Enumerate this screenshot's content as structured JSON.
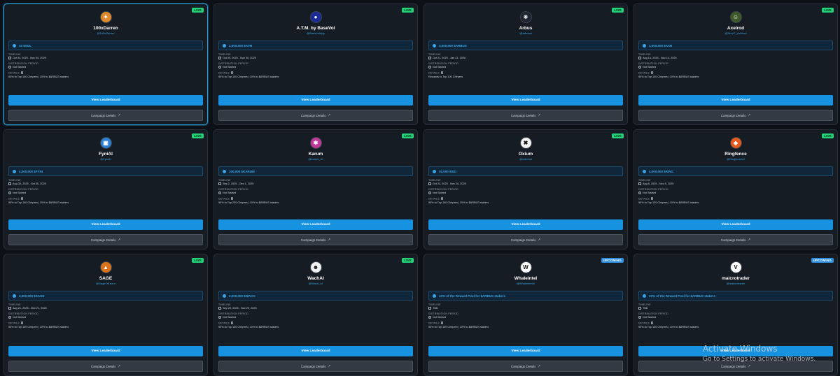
{
  "labels": {
    "timeline": "TIMELINE",
    "distribution": "DISTRIBUTION PERIOD",
    "details": "DETAILS",
    "view_leaderboard": "View Leaderboard",
    "campaign_details": "Campaign Details"
  },
  "campaigns": [
    {
      "name": "100xDarren",
      "handle": "@100xDarren",
      "status": "LIVE",
      "reward": "10 $SOL",
      "timeline": "Oct 04, 2025 - Nov 04, 2025",
      "distribution": "Not Started",
      "details": "90% to Top 100 Chirpers | 10% to $ARBUS stakers",
      "avatar_icon": "gradient-bird-icon",
      "avatar_color": "#e0892c",
      "highlight": true
    },
    {
      "name": "A.T.M. by BaseVol",
      "handle": "@BaseVolApp",
      "status": "LIVE",
      "reward": "2,000,000 $ATM",
      "timeline": "Oct 09, 2025 - Nov 09, 2025",
      "distribution": "Not Started",
      "details": "90% to Top 100 Chirpers | 10% to $ARBUS stakers",
      "avatar_icon": "atm-logo-icon",
      "avatar_color": "#1b2b9a",
      "highlight": false
    },
    {
      "name": "Arbus",
      "handle": "@arbusai",
      "status": "LIVE",
      "reward": "3,000,000 $ARBUS",
      "timeline": "Oct 21, 2025 - Jan 21, 2026",
      "distribution": "Not Started",
      "details": "Rewards to Top 100 Chirpers",
      "avatar_icon": "arbus-logo-icon",
      "avatar_color": "#1e2530",
      "highlight": false
    },
    {
      "name": "Axelrod",
      "handle": "@AIxVC_Axelrod",
      "status": "LIVE",
      "reward": "1,000,000 $AXR",
      "timeline": "Aug 14, 2025 - Nov 14, 2025",
      "distribution": "Not Started",
      "details": "90% to Top 100 Chirpers | 10% to $ARBUS stakers",
      "avatar_icon": "axelrod-portrait-icon",
      "avatar_color": "#3f5a2a",
      "highlight": false
    },
    {
      "name": "FyniAI",
      "handle": "@FyniAI",
      "status": "LIVE",
      "reward": "4,000,000 $FYNI",
      "timeline": "Aug 30, 2025 - Oct 30, 2025",
      "distribution": "Not Started",
      "details": "90% to Top 100 Chirpers | 10% to $ARBUS stakers",
      "avatar_icon": "fyni-logo-icon",
      "avatar_color": "#2c7fd1",
      "highlight": false
    },
    {
      "name": "Karum",
      "handle": "@karum_AI",
      "status": "LIVE",
      "reward": "100,000 $KARUM",
      "timeline": "Sep 2, 2025 - Dec 1, 2025",
      "distribution": "Not Started",
      "details": "90% to Top 200 Chirpers | 10% to $ARBUS stakers",
      "avatar_icon": "karum-logo-icon",
      "avatar_color": "#c0399a",
      "highlight": false
    },
    {
      "name": "Oxium",
      "handle": "@oxiumai",
      "status": "LIVE",
      "reward": "30,000 $SEI",
      "timeline": "Oct 23, 2025 - Nov 24, 2025",
      "distribution": "Not Started",
      "details": "90% to Top 100 Chirpers | 10% to $ARBUS stakers",
      "avatar_icon": "oxium-logo-icon",
      "avatar_color": "#f2f2f2",
      "highlight": false
    },
    {
      "name": "Ringfence",
      "handle": "@RingfenceAI",
      "status": "LIVE",
      "reward": "4,000,000 $RING",
      "timeline": "Aug 5, 2025 - Nov 5, 2025",
      "distribution": "Not Started",
      "details": "90% to Top 100 Chirpers | 10% to $ARBUS stakers",
      "avatar_icon": "ringfence-logo-icon",
      "avatar_color": "#e55a1c",
      "highlight": false
    },
    {
      "name": "SAGE",
      "handle": "@SageOfLearn",
      "status": "LIVE",
      "reward": "3,000,000 $SAGE",
      "timeline": "Aug 21, 2025 - Nov 21, 2025",
      "distribution": "Not Started",
      "details": "90% to Top 100 Chirpers | 10% to $ARBUS stakers",
      "avatar_icon": "fox-icon",
      "avatar_color": "#d9731c",
      "highlight": false
    },
    {
      "name": "WachAI",
      "handle": "@Wach_AI",
      "status": "LIVE",
      "reward": "3,000,000 $WACH",
      "timeline": "Sep 20, 2025 - Nov 20, 2025",
      "distribution": "Not Started",
      "details": "90% to Top 100 Chirpers | 10% to $ARBUS stakers",
      "avatar_icon": "wach-character-icon",
      "avatar_color": "#f0f0f0",
      "highlight": false
    },
    {
      "name": "Whaleintel",
      "handle": "@WhaleintelAI",
      "status": "UPCOMING",
      "reward": "10% of the Reward Pool for $ARBUS stakers",
      "timeline": "TBD",
      "distribution": "Not Started",
      "details": "90% to Top 100 Chirpers | 10% to $ARBUS stakers",
      "avatar_icon": "whaleintel-logo-icon",
      "avatar_color": "#ffffff",
      "highlight": false
    },
    {
      "name": "maicrotrader",
      "handle": "@maicrotrader",
      "status": "UPCOMING",
      "reward": "10% of the Reward Pool for $ARBUS stakers",
      "timeline": "TBD",
      "distribution": "Not Started",
      "details": "90% to Top 100 Chirpers | 10% to $ARBUS stakers",
      "avatar_icon": "maicro-logo-icon",
      "avatar_color": "#ffffff",
      "highlight": false
    }
  ],
  "watermark": {
    "line1": "Activate Windows",
    "line2": "Go to Settings to activate Windows."
  }
}
